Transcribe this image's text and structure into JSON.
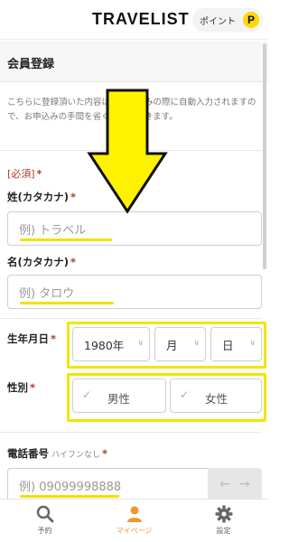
{
  "header": {
    "logo": "TRAVELIST",
    "points_label": "ポイント",
    "points_icon_letter": "P"
  },
  "section": {
    "title": "会員登録"
  },
  "intro": {
    "text": "こちらに登録頂いた内容は、お申込みの際に自動入力されますので、お申込みの手間を省くことができます。"
  },
  "form": {
    "required_note": "[必須]",
    "required_star": "*",
    "last_name_kana": {
      "label": "姓(カタカナ)",
      "placeholder": "例) トラベル"
    },
    "first_name_kana": {
      "label": "名(カタカナ)",
      "placeholder": "例) タロウ"
    },
    "birthdate": {
      "label": "生年月日",
      "year": "1980年",
      "month": "月",
      "day": "日"
    },
    "gender": {
      "label": "性別",
      "options": [
        "男性",
        "女性"
      ]
    },
    "phone": {
      "label": "電話番号",
      "hint": "ハイフンなし",
      "placeholder": "例) 09099998888"
    }
  },
  "bottom_nav": {
    "items": [
      {
        "label": "予約",
        "icon": "search-icon"
      },
      {
        "label": "マイページ",
        "icon": "person-icon",
        "active": true
      },
      {
        "label": "設定",
        "icon": "gear-icon"
      }
    ]
  },
  "colors": {
    "highlight": "#f2e600",
    "required": "#b23a2b",
    "accent": "#f0962d"
  }
}
